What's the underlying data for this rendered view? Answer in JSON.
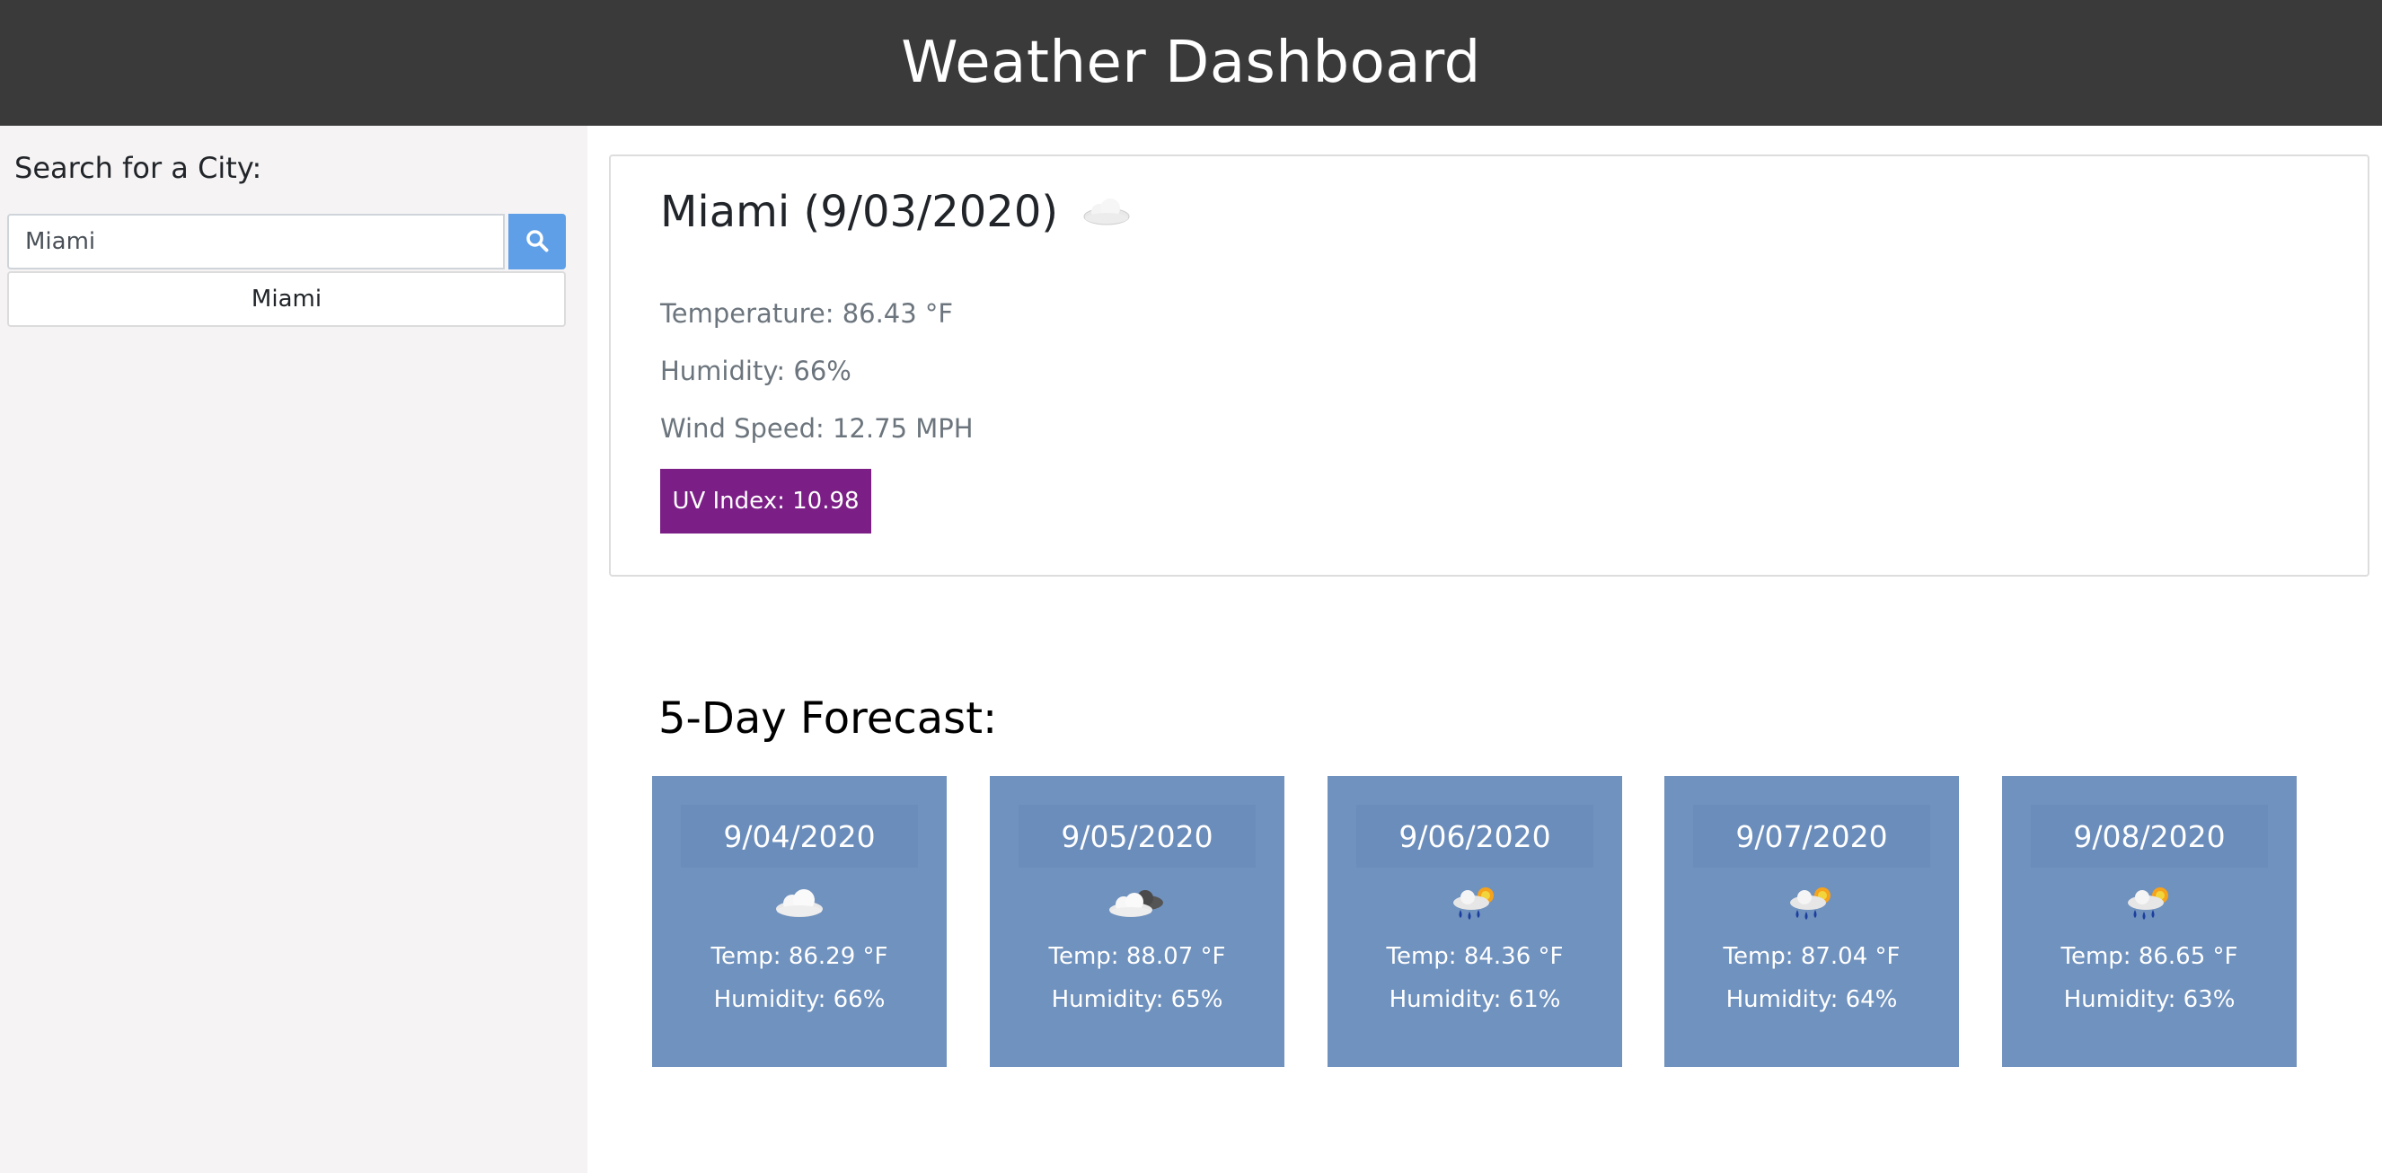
{
  "header": {
    "title": "Weather Dashboard"
  },
  "search": {
    "label": "Search for a City:",
    "value": "Miami",
    "button_icon": "search-icon",
    "history": [
      "Miami"
    ]
  },
  "current": {
    "title": "Miami (9/03/2020)",
    "icon": "cloud-icon",
    "temperature": "Temperature: 86.43 °F",
    "humidity": "Humidity: 66%",
    "wind": "Wind Speed: 12.75 MPH",
    "uv": "UV Index: 10.98",
    "uv_color": "#7b1f86"
  },
  "forecast": {
    "heading": "5-Day Forecast:",
    "days": [
      {
        "date": "9/04/2020",
        "icon": "cloud-icon",
        "temp": "Temp: 86.29 °F",
        "humidity": "Humidity: 66%"
      },
      {
        "date": "9/05/2020",
        "icon": "cloud-dark-cloud-icon",
        "temp": "Temp: 88.07 °F",
        "humidity": "Humidity: 65%"
      },
      {
        "date": "9/06/2020",
        "icon": "rain-sun-icon",
        "temp": "Temp: 84.36 °F",
        "humidity": "Humidity: 61%"
      },
      {
        "date": "9/07/2020",
        "icon": "rain-sun-icon",
        "temp": "Temp: 87.04 °F",
        "humidity": "Humidity: 64%"
      },
      {
        "date": "9/08/2020",
        "icon": "rain-sun-icon",
        "temp": "Temp: 86.65 °F",
        "humidity": "Humidity: 63%"
      }
    ]
  },
  "colors": {
    "header_bg": "#3a3a3a",
    "sidebar_bg": "#f6f3f4",
    "search_button": "#5f9fe8",
    "forecast_card": "#7092be"
  }
}
